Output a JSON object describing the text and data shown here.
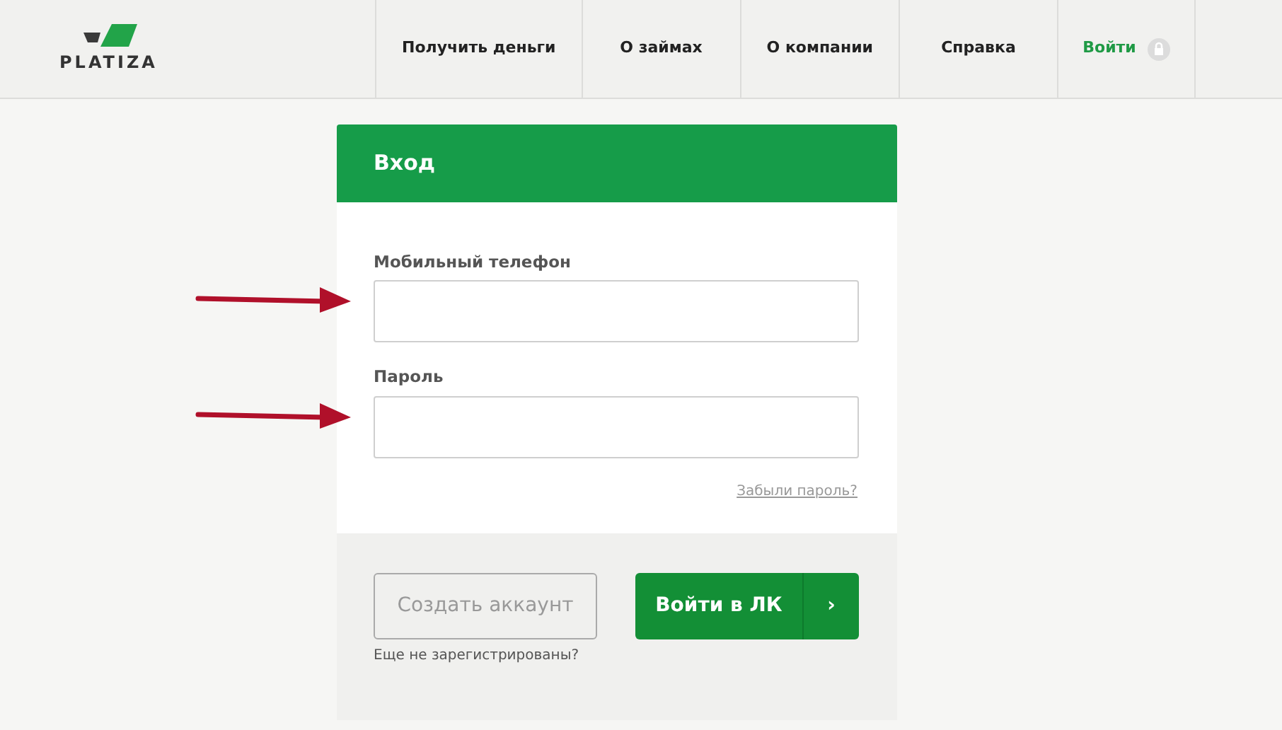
{
  "logo": {
    "text": "PLATIZA"
  },
  "nav": [
    {
      "label": "Получить деньги",
      "kind": "link"
    },
    {
      "label": "О займах",
      "kind": "link"
    },
    {
      "label": "О компании",
      "kind": "link"
    },
    {
      "label": "Справка",
      "kind": "link"
    },
    {
      "label": "Войти",
      "kind": "login"
    }
  ],
  "login_card": {
    "title": "Вход",
    "fields": [
      {
        "label": "Мобильный телефон",
        "annotated": true
      },
      {
        "label": "Пароль",
        "annotated": true
      }
    ],
    "forgot_link": "Забыли пароль?",
    "create_button": "Создать аккаунт",
    "create_hint": "Еще не зарегистрированы?",
    "submit_button": "Войти в ЛК",
    "submit_chevron": "›"
  }
}
